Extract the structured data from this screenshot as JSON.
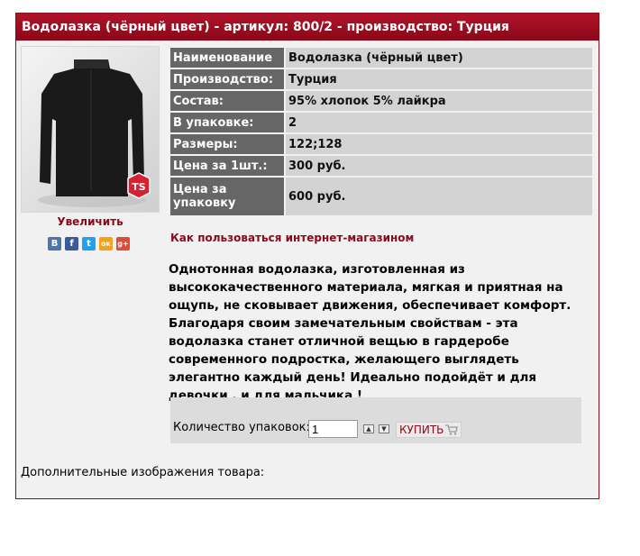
{
  "header": {
    "title": "Водолазка (чёрный цвет) - артикул: 800/2 - производство: Турция"
  },
  "product": {
    "image_alt": "Водолазка (чёрный цвет)",
    "logo": "TS",
    "zoom_label": "Увеличить"
  },
  "social": [
    "В",
    "f",
    "t",
    "ок",
    "g+"
  ],
  "props": [
    {
      "key": "Наименование",
      "value": "Водолазка (чёрный цвет)"
    },
    {
      "key": "Производство:",
      "value": "Турция"
    },
    {
      "key": "Состав:",
      "value": "95% хлопок 5% лайкра"
    },
    {
      "key": "В упаковке:",
      "value": "2"
    },
    {
      "key": "Размеры:",
      "value": "122;128"
    },
    {
      "key": "Цена за 1шт.:",
      "value": "300 руб."
    },
    {
      "key": "Цена за упаковку",
      "value": "600 руб."
    }
  ],
  "howto_link": "Как пользоваться интернет-магазином",
  "description": "Однотонная водолазка, изготовленная из высококачественного материала, мягкая и приятная на ощупь, не сковывает движения, обеспечивает комфорт. Благодаря своим замечательным свойствам - эта водолазка станет отличной вещью в гардеробе современного подростка, желающего выглядеть элегантно каждый день! Идеально подойдёт и для девочки , и для мальчика !",
  "order": {
    "qty_label": "Количество упаковок:",
    "qty_value": "1",
    "buy_label": "КУПИТЬ"
  },
  "extra_images_label": "Дополнительные изображения товара:",
  "colors": {
    "accent": "#8b0a1a",
    "header_bg": "#a00f22",
    "key_bg": "#666666",
    "value_bg": "#d3d3d3"
  }
}
